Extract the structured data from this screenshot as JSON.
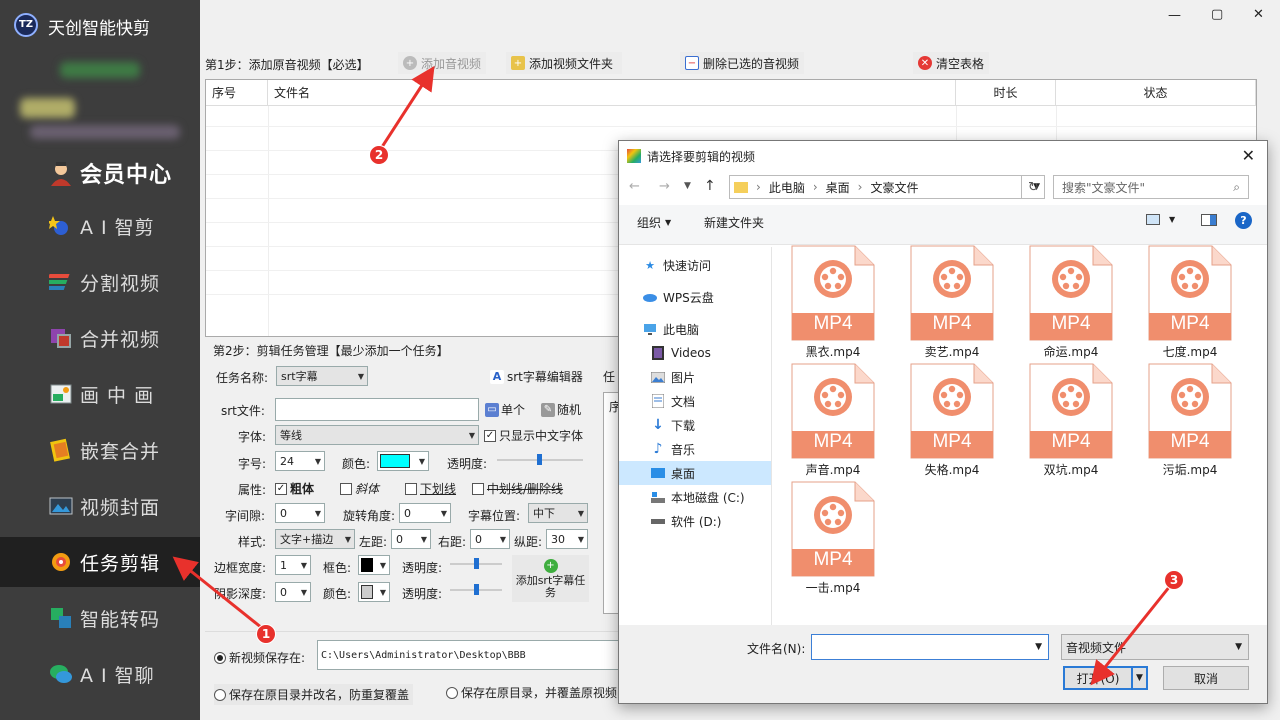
{
  "app": {
    "title": "天创智能快剪",
    "logo": "TZ"
  },
  "window_controls": {
    "minimize": "—",
    "maximize": "▢",
    "close": "✕"
  },
  "sidebar": {
    "member": "会员中心",
    "items": [
      {
        "label": "A I 智剪",
        "icon": "ai-edit-icon"
      },
      {
        "label": "分割视频",
        "icon": "split-video-icon"
      },
      {
        "label": "合并视频",
        "icon": "merge-video-icon"
      },
      {
        "label": "画 中 画",
        "icon": "picture-in-picture-icon"
      },
      {
        "label": "嵌套合并",
        "icon": "nested-merge-icon"
      },
      {
        "label": "视频封面",
        "icon": "video-cover-icon"
      },
      {
        "label": "任务剪辑",
        "icon": "task-edit-icon",
        "active": true
      },
      {
        "label": "智能转码",
        "icon": "transcode-icon"
      },
      {
        "label": "A I 智聊",
        "icon": "ai-chat-icon"
      }
    ]
  },
  "step1": {
    "label": "第1步：添加原音视频【必选】",
    "add_video": "添加音视频",
    "add_folder": "添加视频文件夹",
    "delete_selected": "删除已选的音视频",
    "clear_table": "清空表格"
  },
  "table": {
    "columns": [
      "序号",
      "文件名",
      "时长",
      "状态"
    ]
  },
  "step2": {
    "label": "第2步：剪辑任务管理【最少添加一个任务】",
    "task_name_label": "任务名称:",
    "task_name_value": "srt字幕",
    "srt_editor": "srt字幕编辑器",
    "task_col_partial": "任",
    "list_partial": "序",
    "srt_file_label": "srt文件:",
    "single": "单个",
    "random": "随机",
    "font_label": "字体:",
    "font_value": "等线",
    "only_chinese": "只显示中文字体",
    "size_label": "字号:",
    "size_value": "24",
    "color_label": "颜色:",
    "opacity_label": "透明度:",
    "attr_label": "属性:",
    "bold": "粗体",
    "italic": "斜体",
    "underline": "下划线",
    "strike": "中划线/删除线",
    "spacing_label": "字间隙:",
    "spacing_value": "0",
    "rotate_label": "旋转角度:",
    "rotate_value": "0",
    "position_label": "字幕位置:",
    "position_value": "中下",
    "style_label": "样式:",
    "style_value": "文字+描边",
    "left_label": "左距:",
    "left_value": "0",
    "right_label": "右距:",
    "right_value": "0",
    "vert_label": "纵距:",
    "vert_value": "30",
    "border_label": "边框宽度:",
    "border_value": "1",
    "border_color_label": "框色:",
    "opacity2_label": "透明度:",
    "shadow_label": "阴影深度:",
    "shadow_value": "0",
    "shadow_color_label": "颜色:",
    "opacity3_label": "透明度:",
    "add_task": "添加srt字幕任务"
  },
  "save": {
    "new_save_label": "新视频保存在:",
    "path": "C:\\Users\\Administrator\\Desktop\\BBB",
    "opt_rename": "保存在原目录并改名，防重复覆盖",
    "opt_overwrite": "保存在原目录，并覆盖原视频"
  },
  "dialog": {
    "title": "请选择要剪辑的视频",
    "path": [
      "此电脑",
      "桌面",
      "文豪文件"
    ],
    "search_placeholder": "搜索\"文豪文件\"",
    "organize": "组织",
    "new_folder": "新建文件夹",
    "nav": [
      {
        "label": "快速访问",
        "icon": "star-icon"
      },
      {
        "label": "WPS云盘",
        "icon": "cloud-icon"
      },
      {
        "label": "此电脑",
        "icon": "computer-icon"
      },
      {
        "label": "Videos",
        "icon": "videos-folder-icon"
      },
      {
        "label": "图片",
        "icon": "pictures-folder-icon"
      },
      {
        "label": "文档",
        "icon": "documents-folder-icon"
      },
      {
        "label": "下载",
        "icon": "download-folder-icon"
      },
      {
        "label": "音乐",
        "icon": "music-folder-icon"
      },
      {
        "label": "桌面",
        "icon": "desktop-folder-icon",
        "selected": true
      },
      {
        "label": "本地磁盘 (C:)",
        "icon": "drive-c-icon"
      },
      {
        "label": "软件 (D:)",
        "icon": "drive-d-icon"
      }
    ],
    "files": [
      "黑衣.mp4",
      "卖艺.mp4",
      "命运.mp4",
      "七度.mp4",
      "声音.mp4",
      "失格.mp4",
      "双坑.mp4",
      "污垢.mp4",
      "一击.mp4"
    ],
    "file_badge": "MP4",
    "filename_label": "文件名(N):",
    "filter_value": "音视频文件",
    "open": "打开(O)",
    "cancel": "取消"
  },
  "annotations": [
    "1",
    "2",
    "3"
  ],
  "colors": {
    "font_color": "#00ffff",
    "accent": "#e8312c",
    "mp4": "#f08e6d"
  }
}
